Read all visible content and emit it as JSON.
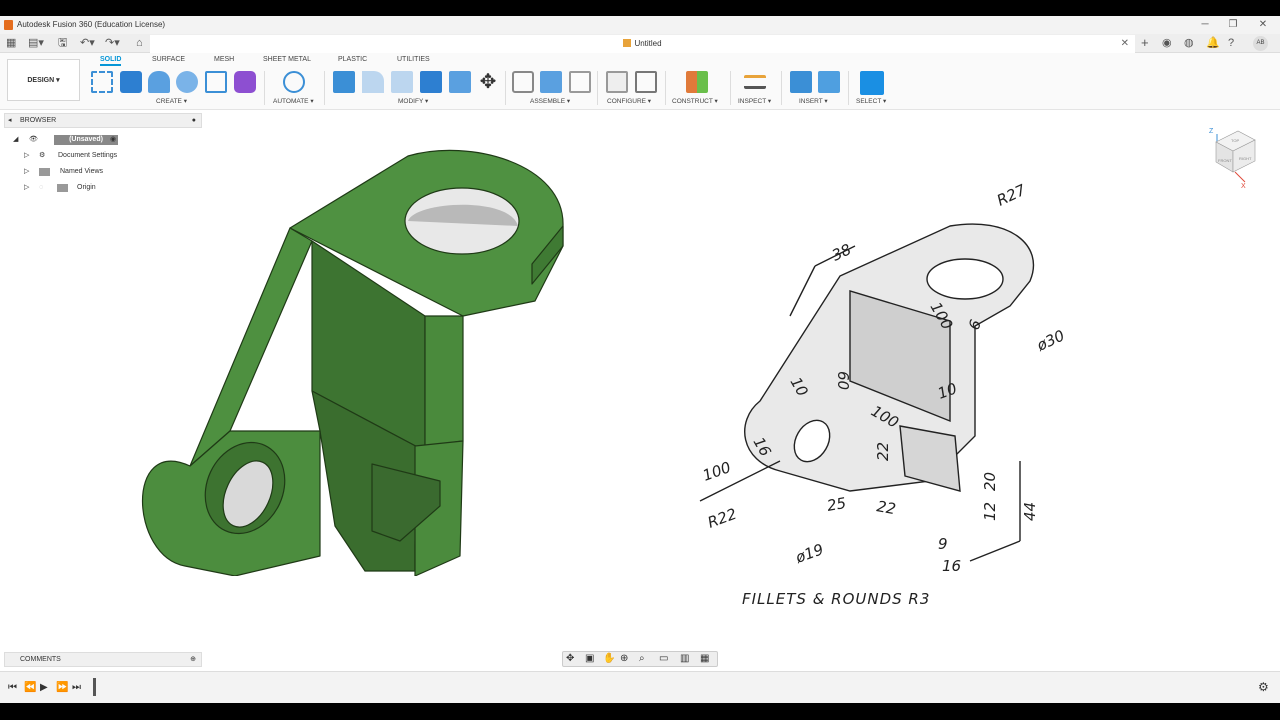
{
  "window": {
    "title": "Autodesk Fusion 360 (Education License)",
    "minimize": "─",
    "maximize": "❐",
    "close": "✕"
  },
  "tabbar": {
    "doc_title": "Untitled",
    "close": "✕",
    "new_tab": "+",
    "user_initials": "AB"
  },
  "toolbar": {
    "workspace": "DESIGN ▾",
    "tabs": [
      "SOLID",
      "SURFACE",
      "MESH",
      "SHEET METAL",
      "PLASTIC",
      "UTILITIES"
    ],
    "groups": [
      "CREATE ▾",
      "AUTOMATE ▾",
      "MODIFY ▾",
      "ASSEMBLE ▾",
      "CONFIGURE ▾",
      "CONSTRUCT ▾",
      "INSPECT ▾",
      "INSERT ▾",
      "SELECT ▾"
    ]
  },
  "browser": {
    "header": "BROWSER",
    "root": "(Unsaved)",
    "items": [
      "Document Settings",
      "Named Views",
      "Origin"
    ]
  },
  "comments": {
    "label": "COMMENTS"
  },
  "viewcube": {
    "axis_z": "Z",
    "axis_x": "X",
    "face_top": "TOP",
    "face_front": "FRONT",
    "face_right": "RIGHT"
  },
  "drawing": {
    "dims": [
      "R27",
      "38",
      "100",
      "6",
      "ø30",
      "10",
      "60",
      "10",
      "100",
      "22",
      "16",
      "100",
      "R22",
      "25",
      "22",
      "ø19",
      "20",
      "12",
      "44",
      "9",
      "16"
    ],
    "caption": "FILLETS & ROUNDS R3"
  },
  "colors": {
    "part_green": "#4a8a3c",
    "accent": "#0696d7"
  }
}
